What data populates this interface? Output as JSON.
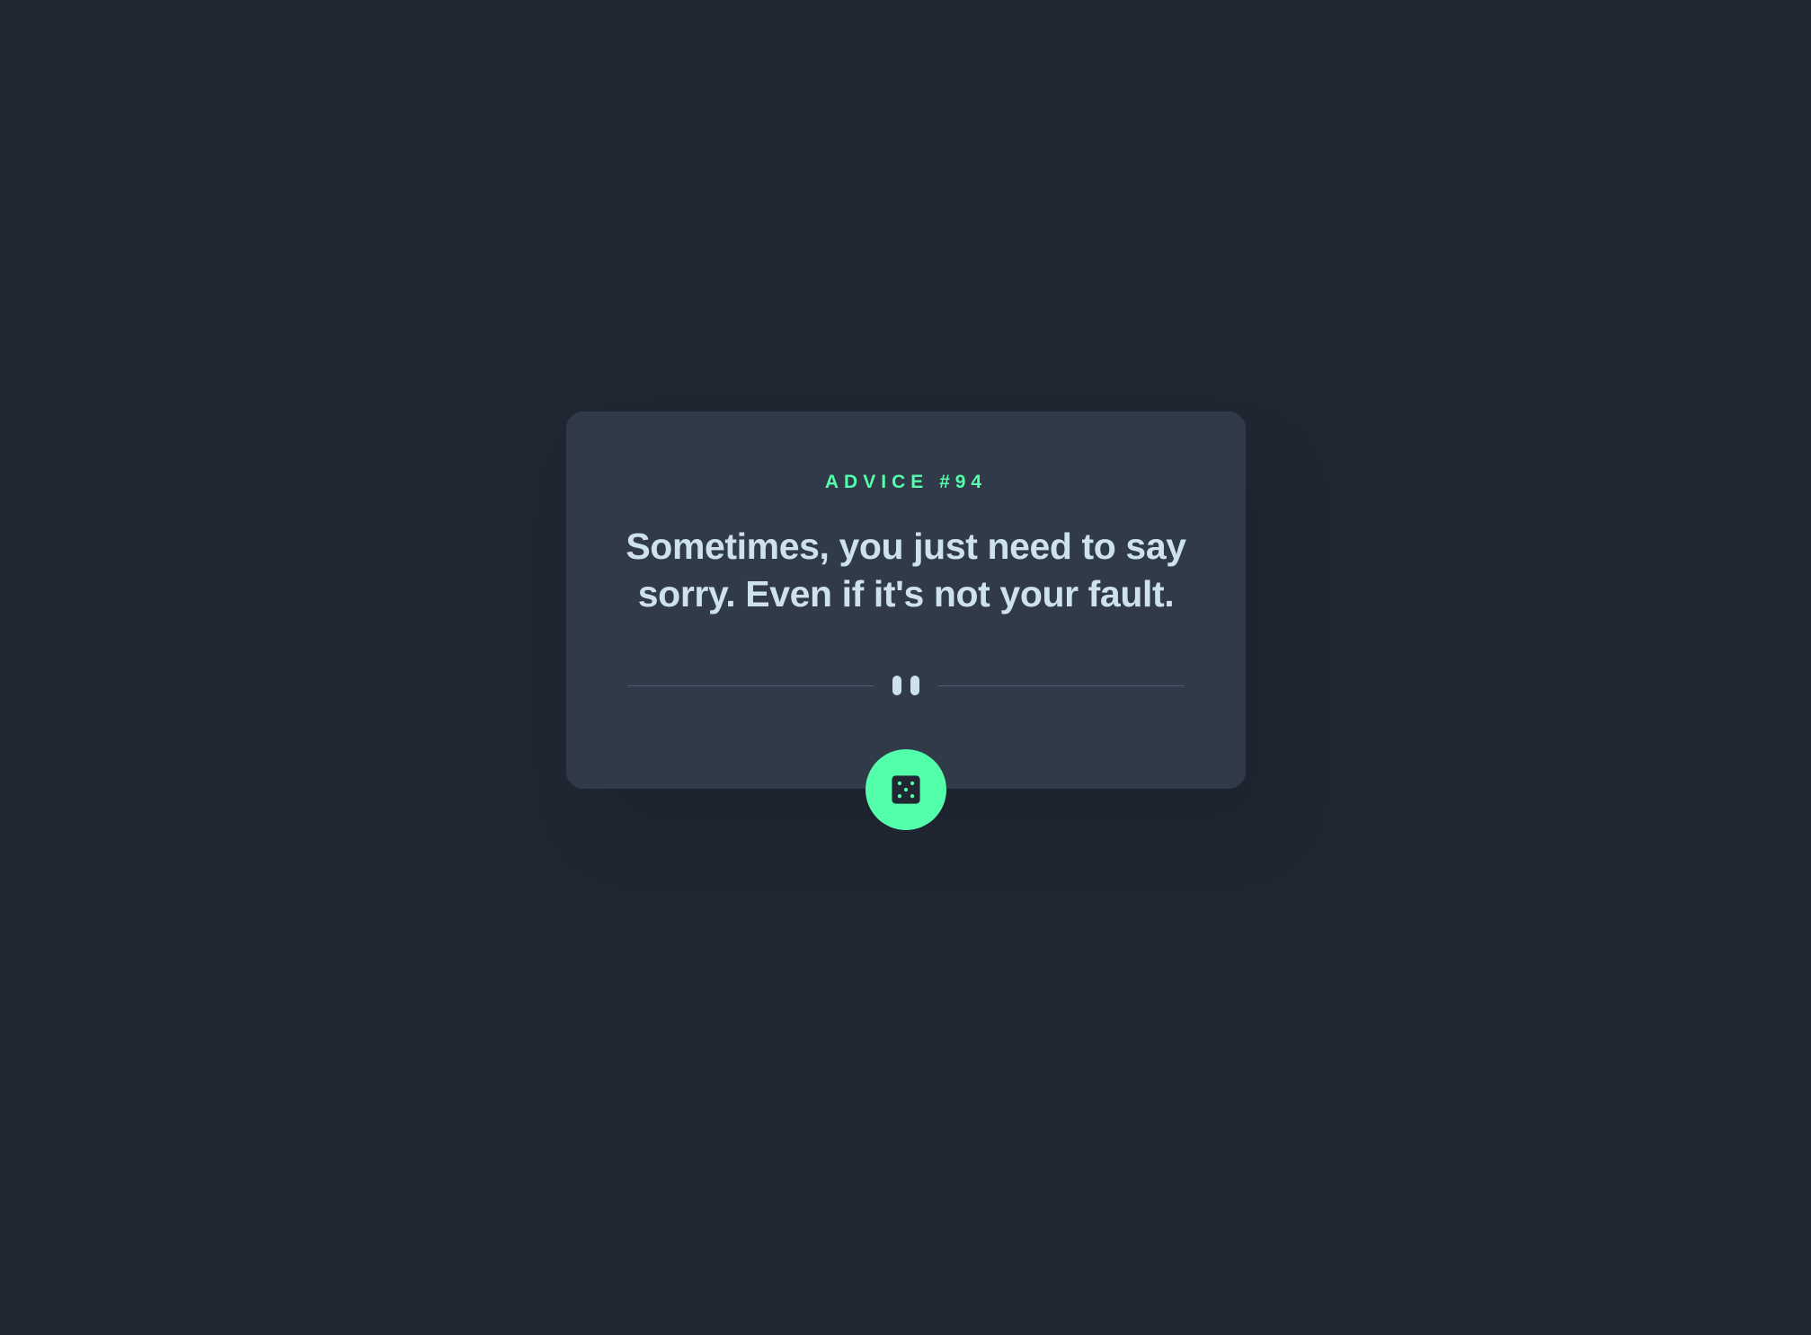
{
  "advice": {
    "label": "ADVICE #94",
    "quote": "Sometimes, you just need to say sorry. Even if it's not your fault."
  },
  "divider": {
    "icon": "pause-icon"
  },
  "button": {
    "icon": "dice-icon"
  },
  "colors": {
    "background": "#202733",
    "card": "#313a49",
    "accent": "#53ffaa",
    "text": "#cee3e9",
    "divider": "#4f5d74"
  }
}
